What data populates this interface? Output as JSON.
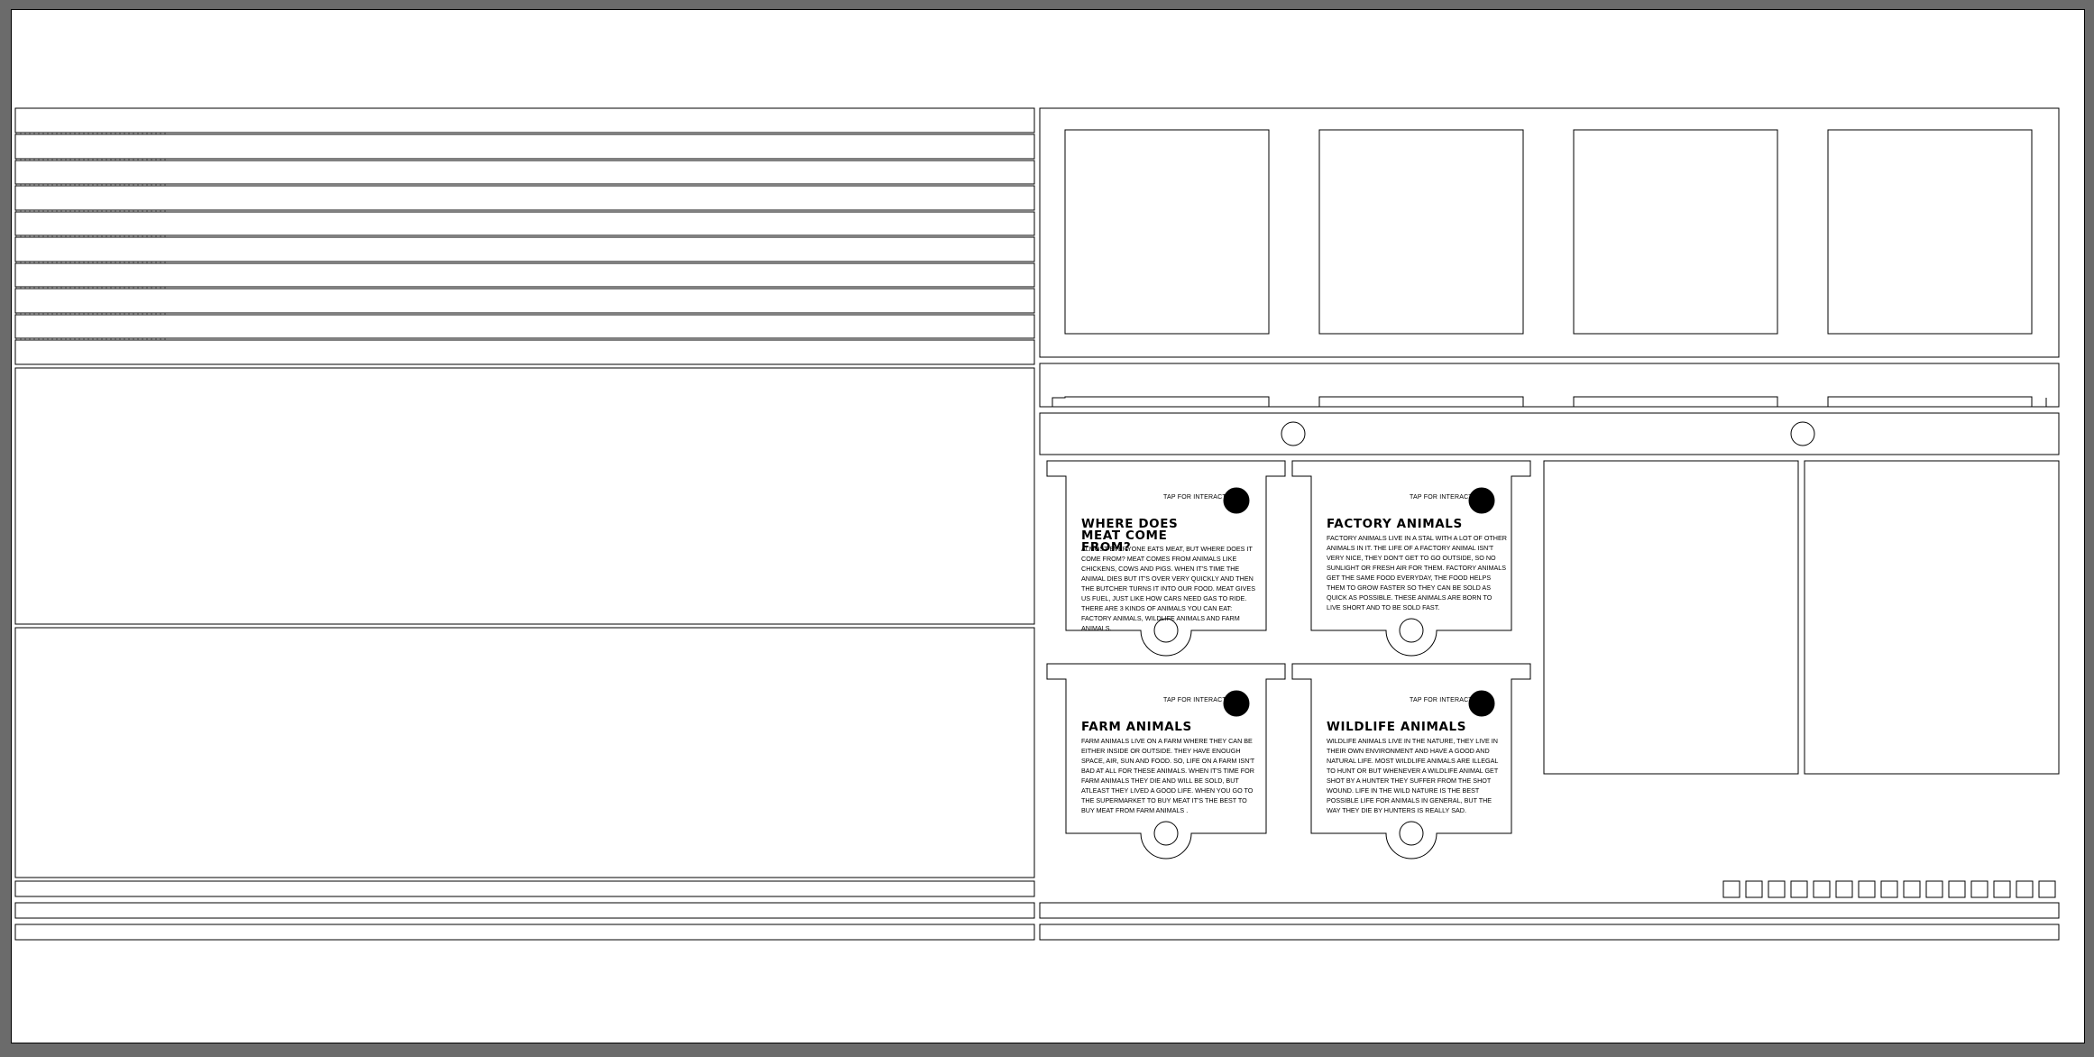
{
  "colors": {
    "background": "#6b6b6b",
    "sheet": "#ffffff",
    "stroke": "#000000"
  },
  "cards": [
    {
      "tap_label": "TAP FOR INTERACTION",
      "title": "WHERE DOES MEAT COME FROM?",
      "body": "ALMOST EVERYONE EATS MEAT, BUT WHERE DOES IT COME FROM? MEAT COMES FROM ANIMALS LIKE CHICKENS, COWS AND PIGS. WHEN IT'S TIME THE ANIMAL DIES BUT IT'S OVER VERY QUICKLY AND THEN THE BUTCHER TURNS IT INTO OUR FOOD. MEAT GIVES US FUEL, JUST LIKE HOW CARS NEED GAS TO RIDE. THERE ARE 3 KINDS OF ANIMALS YOU CAN EAT: FACTORY ANIMALS, WILDLIFE ANIMALS AND FARM ANIMALS.",
      "button_icon": "circle-dot-icon"
    },
    {
      "tap_label": "TAP FOR INTERACTION",
      "title": "FACTORY ANIMALS",
      "body": "FACTORY ANIMALS LIVE IN A STAL WITH A LOT OF OTHER ANIMALS IN IT. THE LIFE OF A FACTORY ANIMAL ISN'T VERY NICE, THEY DON'T GET TO GO OUTSIDE, SO NO SUNLIGHT OR FRESH AIR FOR THEM. FACTORY ANIMALS GET THE SAME FOOD EVERYDAY, THE FOOD HELPS THEM TO GROW FASTER SO THEY CAN BE SOLD AS QUICK AS POSSIBLE. THESE ANIMALS ARE BORN TO LIVE SHORT AND TO BE SOLD FAST.",
      "button_icon": "circle-dot-icon"
    },
    {
      "tap_label": "TAP FOR INTERACTION",
      "title": "FARM ANIMALS",
      "body": "FARM ANIMALS LIVE ON A FARM WHERE THEY CAN BE EITHER INSIDE OR OUTSIDE. THEY HAVE ENOUGH SPACE, AIR, SUN AND FOOD. SO, LIFE ON A FARM ISN'T BAD AT ALL FOR THESE ANIMALS. WHEN IT'S TIME FOR FARM ANIMALS THEY DIE AND WILL BE SOLD, BUT ATLEAST THEY LIVED A GOOD LIFE. WHEN YOU GO TO THE SUPERMARKET TO BUY MEAT IT'S THE BEST TO BUY MEAT FROM FARM ANIMALS .",
      "button_icon": "circle-dot-icon"
    },
    {
      "tap_label": "TAP FOR INTERACTION",
      "title": "WILDLIFE ANIMALS",
      "body": "WILDLIFE ANIMALS LIVE IN THE NATURE, THEY LIVE IN THEIR OWN ENVIRONMENT AND HAVE A GOOD AND NATURAL LIFE. MOST WILDLIFE ANIMALS ARE ILLEGAL TO HUNT OR BUT WHENEVER A WILDLIFE ANIMAL GET SHOT BY A HUNTER THEY SUFFER FROM THE SHOT WOUND. LIFE IN THE WILD NATURE IS THE BEST POSSIBLE LIFE FOR ANIMALS IN GENERAL, BUT THE WAY THEY DIE BY HUNTERS IS REALLY SAD.",
      "button_icon": "circle-dot-icon"
    }
  ],
  "small_squares_count": 15
}
